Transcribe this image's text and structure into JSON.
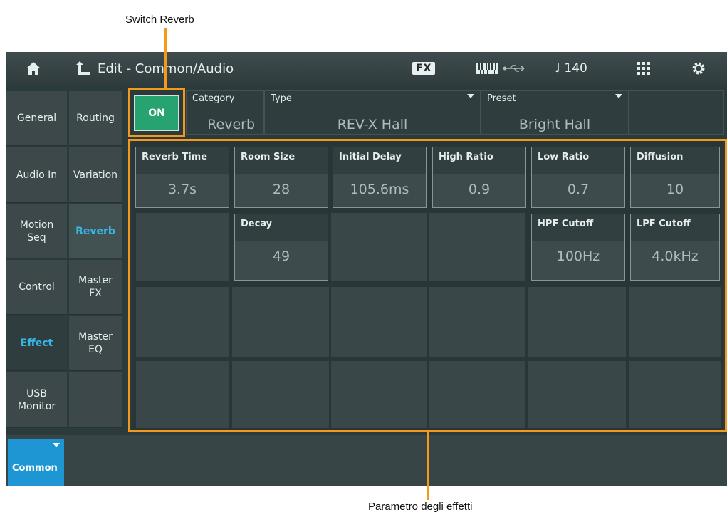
{
  "annotations": {
    "top": "Switch Reverb",
    "bottom": "Parametro degli effetti"
  },
  "header": {
    "title": "Edit - Common/Audio",
    "fx_badge": "FX",
    "tempo": "♩ 140"
  },
  "icons": [
    "home-icon",
    "back-icon",
    "keyboard-icon",
    "usb-icon",
    "grid-icon",
    "gear-icon"
  ],
  "nav_primary": [
    {
      "label": "General",
      "selected": false
    },
    {
      "label": "Audio In",
      "selected": false
    },
    {
      "label": "Motion\nSeq",
      "selected": false
    },
    {
      "label": "Control",
      "selected": false
    },
    {
      "label": "Effect",
      "selected": true
    },
    {
      "label": "USB\nMonitor",
      "selected": false
    }
  ],
  "nav_secondary": [
    {
      "label": "Routing",
      "selected": false
    },
    {
      "label": "Variation",
      "selected": false
    },
    {
      "label": "Reverb",
      "selected": true
    },
    {
      "label": "Master\nFX",
      "selected": false
    },
    {
      "label": "Master\nEQ",
      "selected": false
    }
  ],
  "switch": {
    "label": "ON"
  },
  "category": {
    "label": "Category",
    "value": "Reverb"
  },
  "type": {
    "label": "Type",
    "value": "REV-X Hall"
  },
  "preset": {
    "label": "Preset",
    "value": "Bright Hall"
  },
  "params": {
    "reverb_time": {
      "label": "Reverb Time",
      "value": "3.7s"
    },
    "room_size": {
      "label": "Room Size",
      "value": "28"
    },
    "initial_delay": {
      "label": "Initial Delay",
      "value": "105.6ms"
    },
    "high_ratio": {
      "label": "High Ratio",
      "value": "0.9"
    },
    "low_ratio": {
      "label": "Low Ratio",
      "value": "0.7"
    },
    "diffusion": {
      "label": "Diffusion",
      "value": "10"
    },
    "decay": {
      "label": "Decay",
      "value": "49"
    },
    "hpf_cutoff": {
      "label": "HPF Cutoff",
      "value": "100Hz"
    },
    "lpf_cutoff": {
      "label": "LPF Cutoff",
      "value": "4.0kHz"
    }
  },
  "bottom_tab": {
    "label": "Common"
  },
  "colors": {
    "accent_blue": "#36b7e6",
    "on_green": "#27a36f",
    "callout_orange": "#f39a1e",
    "common_blue": "#1e96d4"
  }
}
